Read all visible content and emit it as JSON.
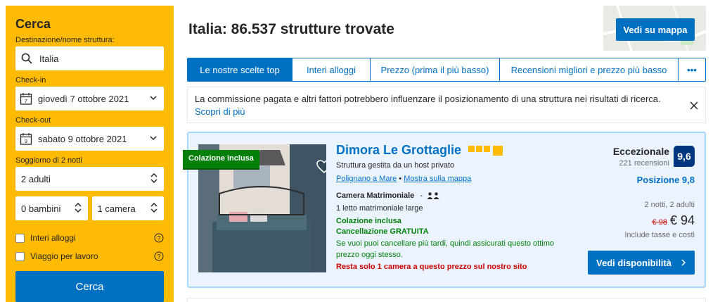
{
  "sidebar": {
    "title": "Cerca",
    "destination_label": "Destinazione/nome struttura:",
    "destination_value": "Italia",
    "checkin_label": "Check-in",
    "checkin_value": "giovedì 7 ottobre 2021",
    "checkin_day": "7",
    "checkout_label": "Check-out",
    "checkout_value": "sabato 9 ottobre 2021",
    "checkout_day": "9",
    "stay_label": "Soggiorno di 2 notti",
    "adults": "2 adulti",
    "children": "0 bambini",
    "rooms": "1 camera",
    "filter_entire": "Interi alloggi",
    "filter_business": "Viaggio per lavoro",
    "search_button": "Cerca"
  },
  "header": {
    "title": "Italia: 86.537 strutture trovate",
    "map_button": "Vedi su mappa"
  },
  "tabs": [
    {
      "label": "Le nostre scelte top"
    },
    {
      "label": "Interi alloggi"
    },
    {
      "label": "Prezzo (prima il più basso)"
    },
    {
      "label": "Recensioni migliori e prezzo più basso"
    },
    {
      "label": "•••"
    }
  ],
  "notice": {
    "text": "La commissione pagata e altri fattori potrebbero influenzare il posizionamento di una struttura nei risultati di ricerca.",
    "link": "Scopri di più"
  },
  "listing": {
    "ribbon": "Colazione inclusa",
    "name": "Dimora Le Grottaglie",
    "stars": 3,
    "host": "Struttura gestita da un host privato",
    "location": "Polignano a Mare",
    "map_link": "Mostra sulla mappa",
    "room_type": "Camera Matrimoniale",
    "room_sep": "-",
    "bed": "1 letto matrimoniale large",
    "breakfast": "Colazione inclusa",
    "cancellation": "Cancellazione GRATUITA",
    "cancellation_note": "Se vuoi puoi cancellare più tardi, quindi assicurati questo ottimo prezzo oggi stesso.",
    "scarcity": "Resta solo 1 camera a questo prezzo sul nostro sito",
    "score_word": "Eccezionale",
    "reviews": "221 recensioni",
    "score": "9,6",
    "position": "Posizione 9,8",
    "nights": "2 notti, 2 adulti",
    "old_price": "€ 98",
    "new_price": "€ 94",
    "taxes": "Include tasse e costi",
    "availability_button": "Vedi disponibilità"
  },
  "colors": {
    "accent": "#0071c2",
    "sidebar": "#febb02",
    "score": "#003580",
    "green": "#008009",
    "red": "#cc0000"
  }
}
